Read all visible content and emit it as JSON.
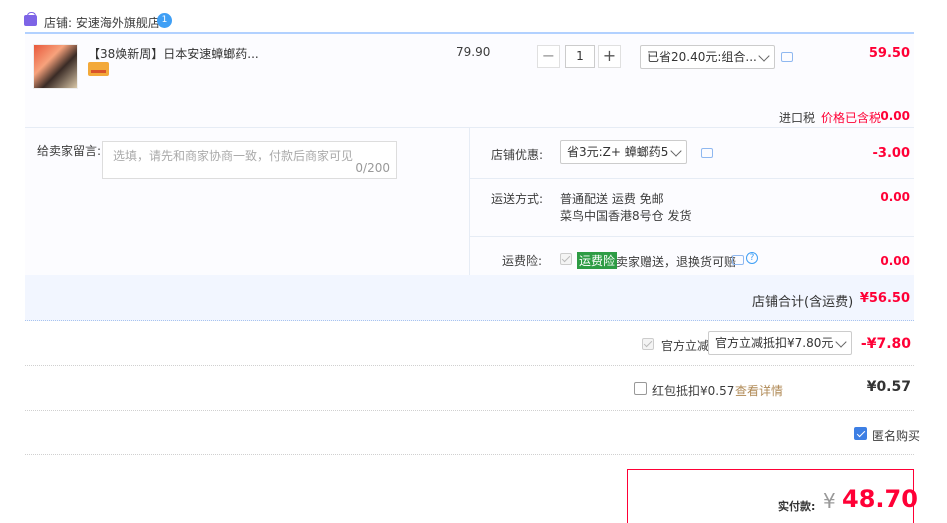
{
  "shop": {
    "label": "店铺: 安速海外旗舰店",
    "badge": "1"
  },
  "item": {
    "title": "【38焕新周】日本安速蟑螂药...",
    "unit_price": "79.90",
    "quantity": "1",
    "qty_minus": "−",
    "qty_plus": "+",
    "promo_select": "已省20.40元:组合...",
    "subtotal": "59.50",
    "tax_label": "进口税",
    "tax_note": "价格已含税",
    "tax_value": "0.00"
  },
  "message": {
    "label": "给卖家留言:",
    "placeholder": "选填，请先和商家协商一致，付款后商家可见",
    "counter": "0/200"
  },
  "shop_discount": {
    "label": "店铺优惠:",
    "select": "省3元:Z+ 蟑螂药5",
    "value": "-3.00"
  },
  "shipping": {
    "label": "运送方式:",
    "line1": "普通配送 运费 免邮",
    "line2": "菜鸟中国香港8号仓  发货",
    "value": "0.00"
  },
  "insurance": {
    "label": "运费险:",
    "tag": "运费险",
    "desc": "卖家赠送，退换货可赔",
    "help": "?",
    "value": "0.00"
  },
  "shop_total": {
    "label": "店铺合计(含运费)",
    "value": "¥56.50"
  },
  "official": {
    "label": "官方立减",
    "select": "官方立减抵扣¥7.80元",
    "value": "-¥7.80"
  },
  "redpacket": {
    "label": "红包抵扣¥0.57",
    "link": "查看详情",
    "value": "¥0.57"
  },
  "anonymous": {
    "label": "匿名购买"
  },
  "payment": {
    "label": "实付款:",
    "currency": "¥",
    "value": "48.70"
  },
  "colors": {
    "accent": "#ff0036",
    "brand_blue": "#3d7fe4",
    "border_blue": "#b2d1ff"
  }
}
